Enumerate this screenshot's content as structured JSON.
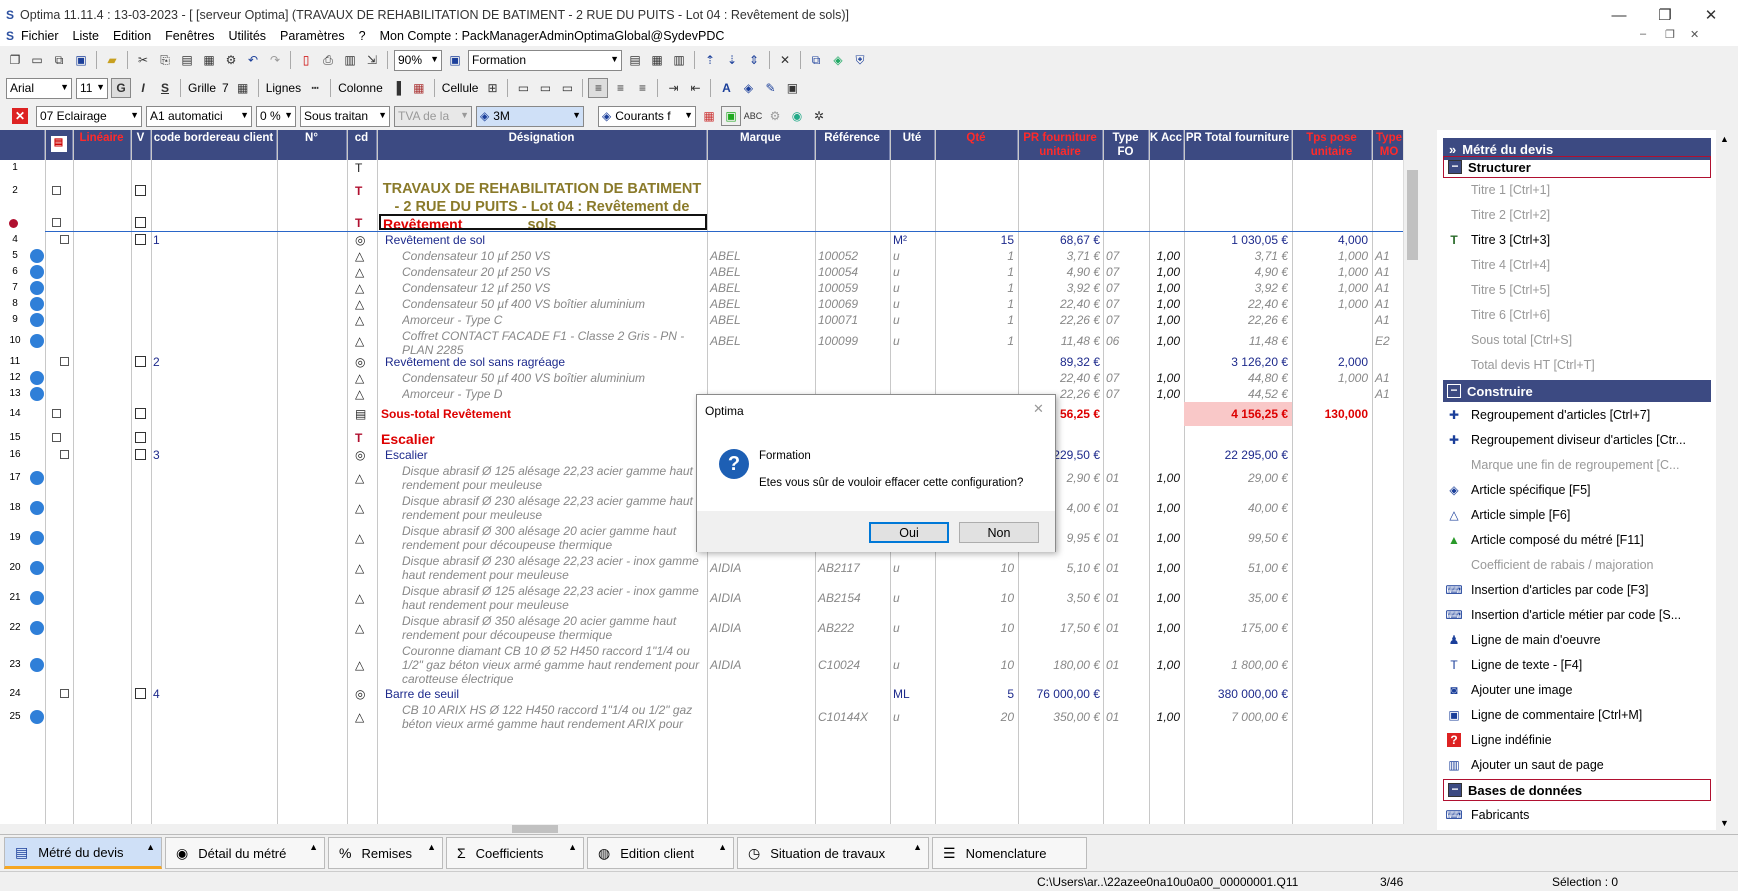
{
  "window": {
    "title": "Optima 11.11.4 : 13-03-2023 - [ [serveur Optima] (TRAVAUX DE REHABILITATION DE BATIMENT - 2 RUE DU PUITS - Lot 04 : Revêtement de sols)]",
    "minimize": "—",
    "restore": "❐",
    "close": "✕",
    "mdi_min": "–",
    "mdi_restore": "❐",
    "mdi_close": "✕"
  },
  "menu": [
    "Fichier",
    "Liste",
    "Edition",
    "Fenêtres",
    "Utilités",
    "Paramètres",
    "?",
    "Mon Compte : PackManagerAdminOptimaGlobal@SydevPDC"
  ],
  "toolbar1": {
    "zoom": "90%",
    "profile": "Formation"
  },
  "toolbar2": {
    "font": "Arial",
    "size": "11",
    "bold": "G",
    "italic": "I",
    "strike": "S",
    "grille": "Grille",
    "grille_val": "7",
    "lignes": "Lignes",
    "colonne": "Colonne",
    "cellule": "Cellule"
  },
  "toolbar3": {
    "lot": "07 Eclairage",
    "tva_mode": "A1 automatici",
    "pct": "0 %",
    "sous_traitance": "Sous traitan",
    "tva": "TVA de la",
    "unit": "3M",
    "courants": "Courants f"
  },
  "grid_header": {
    "lineaire": "Linéaire",
    "v": "V",
    "code_bordereau": "code bordereau client",
    "numero": "N°",
    "cd": "cd",
    "designation": "Désignation",
    "marque": "Marque",
    "reference": "Référence",
    "ute": "Uté",
    "qte": "Qté",
    "pr_fourniture": "PR fourniture unitaire",
    "type_fo": "Type FO",
    "k_acc": "K Acc",
    "pr_total": "PR Total fourniture",
    "tps_pose": "Tps pose unitaire",
    "type_mo": "Type MO",
    "p": "P"
  },
  "rows": [
    {
      "n": "1",
      "type": "text",
      "des": ""
    },
    {
      "n": "2",
      "type": "titre",
      "des": "TRAVAUX DE REHABILITATION DE BATIMENT - 2 RUE DU PUITS - Lot 04 : Revêtement de sols"
    },
    {
      "n": "",
      "type": "section",
      "des": "Revêtement"
    },
    {
      "n": "4",
      "type": "grp",
      "num": "1",
      "des": "Revêtement de sol",
      "ute": "M²",
      "qte": "15",
      "pru": "68,67 €",
      "prt": "1 030,05 €",
      "tps": "4,000"
    },
    {
      "n": "5",
      "type": "art",
      "des": "Condensateur 10 µf 250 VS",
      "marque": "ABEL",
      "ref": "100052",
      "ute": "u",
      "qte": "1",
      "pru": "3,71 €",
      "fo": "07",
      "k": "1,00",
      "prt": "3,71 €",
      "tps": "1,000",
      "mo": "A1"
    },
    {
      "n": "6",
      "type": "art",
      "des": "Condensateur 20 µf 250 VS",
      "marque": "ABEL",
      "ref": "100054",
      "ute": "u",
      "qte": "1",
      "pru": "4,90 €",
      "fo": "07",
      "k": "1,00",
      "prt": "4,90 €",
      "tps": "1,000",
      "mo": "A1"
    },
    {
      "n": "7",
      "type": "art",
      "des": "Condensateur 12 µf 250 VS",
      "marque": "ABEL",
      "ref": "100059",
      "ute": "u",
      "qte": "1",
      "pru": "3,92 €",
      "fo": "07",
      "k": "1,00",
      "prt": "3,92 €",
      "tps": "1,000",
      "mo": "A1"
    },
    {
      "n": "8",
      "type": "art",
      "des": "Condensateur 50 µf 400 VS boîtier aluminium",
      "marque": "ABEL",
      "ref": "100069",
      "ute": "u",
      "qte": "1",
      "pru": "22,40 €",
      "fo": "07",
      "k": "1,00",
      "prt": "22,40 €",
      "tps": "1,000",
      "mo": "A1"
    },
    {
      "n": "9",
      "type": "art",
      "des": "Amorceur - Type C",
      "marque": "ABEL",
      "ref": "100071",
      "ute": "u",
      "qte": "1",
      "pru": "22,26 €",
      "fo": "07",
      "k": "1,00",
      "prt": "22,26 €",
      "tps": "",
      "mo": "A1"
    },
    {
      "n": "10",
      "type": "art",
      "des": "Coffret CONTACT FACADE F1 - Classe 2 Gris - PN - PLAN 2285",
      "marque": "ABEL",
      "ref": "100099",
      "ute": "u",
      "qte": "1",
      "pru": "11,48 €",
      "fo": "06",
      "k": "1,00",
      "prt": "11,48 €",
      "tps": "",
      "mo": "E2"
    },
    {
      "n": "11",
      "type": "grp",
      "num": "2",
      "des": "Revêtement de sol sans ragréage",
      "pru": "89,32 €",
      "prt": "3 126,20 €",
      "tps": "2,000"
    },
    {
      "n": "12",
      "type": "art",
      "des": "Condensateur 50 µf 400 VS boîtier aluminium",
      "pru": "22,40 €",
      "fo": "07",
      "k": "1,00",
      "prt": "44,80 €",
      "tps": "1,000",
      "mo": "A1"
    },
    {
      "n": "13",
      "type": "art",
      "des": "Amorceur - Type D",
      "pru": "22,26 €",
      "fo": "07",
      "k": "1,00",
      "prt": "44,52 €",
      "tps": "",
      "mo": "A1"
    },
    {
      "n": "14",
      "type": "sous",
      "des": "Sous-total Revêtement",
      "pru": "56,25 €",
      "prt": "4 156,25 €",
      "tps": "130,000"
    },
    {
      "n": "15",
      "type": "section",
      "des": "Escalier"
    },
    {
      "n": "16",
      "type": "grp",
      "num": "3",
      "des": "Escalier",
      "pru": "229,50 €",
      "prt": "22 295,00 €"
    },
    {
      "n": "17",
      "type": "art",
      "des": "Disque abrasif Ø 125 alésage 22,23 acier gamme haut rendement pour meuleuse",
      "pru": "2,90 €",
      "fo": "01",
      "k": "1,00",
      "prt": "29,00 €"
    },
    {
      "n": "18",
      "type": "art",
      "des": "Disque abrasif Ø 230 alésage 22,23 acier gamme haut rendement pour meuleuse",
      "marque": "AIDIA",
      "ref": "AB209",
      "ute": "u",
      "qte": "10",
      "pru": "4,00 €",
      "fo": "01",
      "k": "1,00",
      "prt": "40,00 €"
    },
    {
      "n": "19",
      "type": "art",
      "des": "Disque abrasif Ø 300 alésage 20 acier gamme haut rendement pour découpeuse thermique",
      "marque": "AIDIA",
      "ref": "AB210",
      "ute": "u",
      "qte": "10",
      "pru": "9,95 €",
      "fo": "01",
      "k": "1,00",
      "prt": "99,50 €"
    },
    {
      "n": "20",
      "type": "art",
      "des": "Disque abrasif Ø 230 alésage 22,23 acier - inox gamme haut rendement pour meuleuse",
      "marque": "AIDIA",
      "ref": "AB2117",
      "ute": "u",
      "qte": "10",
      "pru": "5,10 €",
      "fo": "01",
      "k": "1,00",
      "prt": "51,00 €"
    },
    {
      "n": "21",
      "type": "art",
      "des": "Disque abrasif Ø 125 alésage 22,23 acier - inox gamme haut rendement pour meuleuse",
      "marque": "AIDIA",
      "ref": "AB2154",
      "ute": "u",
      "qte": "10",
      "pru": "3,50 €",
      "fo": "01",
      "k": "1,00",
      "prt": "35,00 €"
    },
    {
      "n": "22",
      "type": "art",
      "des": "Disque abrasif Ø 350 alésage 20 acier gamme haut rendement pour découpeuse thermique",
      "marque": "AIDIA",
      "ref": "AB222",
      "ute": "u",
      "qte": "10",
      "pru": "17,50 €",
      "fo": "01",
      "k": "1,00",
      "prt": "175,00 €"
    },
    {
      "n": "23",
      "type": "art",
      "des": "Couronne diamant CB 10 Ø 52 H450 raccord 1\"1/4 ou 1/2\" gaz béton vieux armé gamme haut rendement pour carotteuse électrique",
      "marque": "AIDIA",
      "ref": "C10024",
      "ute": "u",
      "qte": "10",
      "pru": "180,00 €",
      "fo": "01",
      "k": "1,00",
      "prt": "1 800,00 €"
    },
    {
      "n": "24",
      "type": "grp",
      "num": "4",
      "des": "Barre de seuil",
      "ute": "ML",
      "qte": "5",
      "pru": "76 000,00 €",
      "prt": "380 000,00 €"
    },
    {
      "n": "25",
      "type": "art",
      "des": "CB 10 ARIX HS Ø 122 H450 raccord 1\"1/4 ou 1/2\" gaz béton vieux armé gamme haut rendement ARIX pour",
      "ref": "C10144X",
      "ute": "u",
      "qte": "20",
      "pru": "350,00 €",
      "fo": "01",
      "k": "1,00",
      "prt": "7 000,00 €"
    }
  ],
  "right_panel": {
    "title": "Métré du devis",
    "sections": [
      {
        "label": "Structurer",
        "items": [
          {
            "label": "Titre 1 [Ctrl+1]",
            "dis": true
          },
          {
            "label": "Titre 2 [Ctrl+2]",
            "dis": true
          },
          {
            "label": "Titre 3 [Ctrl+3]",
            "dis": false
          },
          {
            "label": "Titre 4 [Ctrl+4]",
            "dis": true
          },
          {
            "label": "Titre 5 [Ctrl+5]",
            "dis": true
          },
          {
            "label": "Titre 6 [Ctrl+6]",
            "dis": true
          },
          {
            "label": "Sous total [Ctrl+S]",
            "dis": true
          },
          {
            "label": "Total devis HT [Ctrl+T]",
            "dis": true
          }
        ]
      },
      {
        "label": "Construire",
        "items": [
          {
            "label": "Regroupement d'articles [Ctrl+7]",
            "dis": false
          },
          {
            "label": "Regroupement diviseur d'articles [Ctr...",
            "dis": false
          },
          {
            "label": "Marque une fin de regroupement [C...",
            "dis": true
          },
          {
            "label": "Article spécifique [F5]",
            "dis": false
          },
          {
            "label": "Article simple [F6]",
            "dis": false
          },
          {
            "label": "Article composé du métré [F11]",
            "dis": false
          },
          {
            "label": "Coefficient de rabais / majoration",
            "dis": true
          },
          {
            "label": "Insertion d'articles par code [F3]",
            "dis": false
          },
          {
            "label": "Insertion d'article métier par code [S...",
            "dis": false
          },
          {
            "label": "Ligne de main d'oeuvre",
            "dis": false
          },
          {
            "label": "Ligne de texte - [F4]",
            "dis": false
          },
          {
            "label": "Ajouter une image",
            "dis": false
          },
          {
            "label": "Ligne de commentaire [Ctrl+M]",
            "dis": false
          },
          {
            "label": "Ligne indéfinie",
            "dis": false
          },
          {
            "label": "Ajouter un saut de page",
            "dis": false
          }
        ]
      },
      {
        "label": "Bases de données",
        "items": [
          {
            "label": "Fabricants",
            "dis": false
          }
        ]
      }
    ]
  },
  "tabs": [
    "Métré du devis",
    "Détail du métré",
    "Remises",
    "Coefficients",
    "Edition client",
    "Situation de travaux",
    "Nomenclature"
  ],
  "status": {
    "path": "C:\\Users\\ar..\\22azee0na10u0a00_00000001.Q11",
    "page": "3/46",
    "selection": "Sélection : 0"
  },
  "dialog": {
    "title": "Optima",
    "heading": "Formation",
    "message": "Etes vous sûr de vouloir effacer cette configuration?",
    "yes": "Oui",
    "no": "Non",
    "close": "✕"
  }
}
